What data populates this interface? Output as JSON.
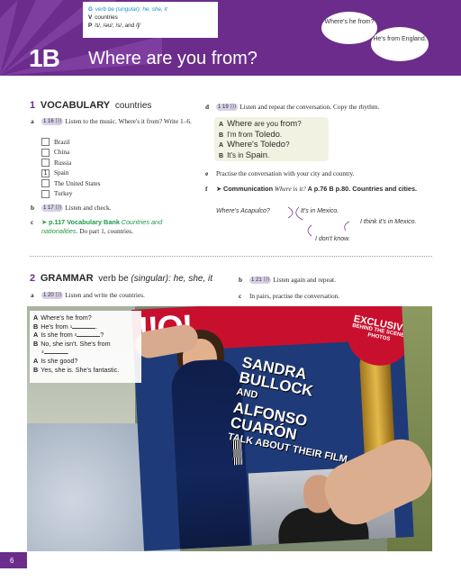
{
  "header": {
    "objectives": {
      "grammar_label": "G",
      "grammar_text": "verb be (singular): he, she, it",
      "vocab_label": "V",
      "vocab_text": "countries",
      "pron_label": "P",
      "pron_text": "/ɪ/, /əʊ/, /s/, and /ʃ/"
    },
    "lesson_number": "1B",
    "lesson_title": "Where are you from?",
    "bubble_question": "Where's he from?",
    "bubble_answer": "He's from England."
  },
  "vocabulary": {
    "num": "1",
    "heading": "VOCABULARY",
    "sub": "countries",
    "a_letter": "a",
    "a_track": "1 16",
    "a_text": "Listen to the music. Where's it from? Write 1–6.",
    "countries": [
      {
        "box": "",
        "name": "Brazil"
      },
      {
        "box": "",
        "name": "China"
      },
      {
        "box": "",
        "name": "Russia"
      },
      {
        "box": "1",
        "name": "Spain"
      },
      {
        "box": "",
        "name": "The United States"
      },
      {
        "box": "",
        "name": "Turkey"
      }
    ],
    "b_letter": "b",
    "b_track": "1 17",
    "b_text": "Listen and check.",
    "c_letter": "c",
    "c_link": "p.117 Vocabulary Bank",
    "c_link_italic": "Countries and nationalities",
    "c_text": ". Do part 1, countries."
  },
  "right_col": {
    "d_letter": "d",
    "d_track": "1 19",
    "d_text": "Listen and repeat the conversation. Copy the rhythm.",
    "dialog": [
      {
        "speaker": "A",
        "pre": "Where",
        "mid": " are you ",
        "post": "from",
        "end": "?"
      },
      {
        "speaker": "B",
        "pre": "I'm from ",
        "mid": "",
        "post": "Toledo",
        "end": "."
      },
      {
        "speaker": "A",
        "pre": "Where's ",
        "mid": "",
        "post": "Toledo",
        "end": "?"
      },
      {
        "speaker": "B",
        "pre": "It's in ",
        "mid": "",
        "post": "Spain",
        "end": "."
      }
    ],
    "e_letter": "e",
    "e_text": "Practise the conversation with your city and country.",
    "f_letter": "f",
    "f_bold": "Communication",
    "f_italic": "Where is it?",
    "f_ref": " A p.76 B p.80. Countries and cities.",
    "hand_q": "Where's Acapulco?",
    "hand_a1": "It's in Mexico.",
    "hand_a2": "I think it's in Mexico.",
    "hand_a3": "I don't know."
  },
  "grammar": {
    "num": "2",
    "heading": "GRAMMAR",
    "sub_plain": "verb be",
    "sub_rest": " (singular): he, she, it",
    "a_letter": "a",
    "a_track": "1 20",
    "a_text": "Listen and write the countries.",
    "b_letter": "b",
    "b_track": "1 21",
    "b_text": "Listen again and repeat.",
    "c_letter": "c",
    "c_text": "In pairs, practise the conversation."
  },
  "photo_dialog": [
    {
      "speaker": "A",
      "text": "Where's he from?"
    },
    {
      "speaker": "B",
      "text": "He's from",
      "gap": "1"
    },
    {
      "speaker": "A",
      "text": "Is she from",
      "gap": "2",
      "end": "?"
    },
    {
      "speaker": "B",
      "text": "No, she isn't. She's from",
      "gap": "3"
    },
    {
      "speaker": "A",
      "text": "Is she good?"
    },
    {
      "speaker": "B",
      "text": "Yes, she is. She's fantastic."
    }
  ],
  "magazine": {
    "exclusive_1": "EXCLUSIVE",
    "exclusive_2": "BEHIND THE SCENES PHOTOS",
    "headline_1": "SANDRA",
    "headline_2": "BULLOCK",
    "headline_3": "AND",
    "headline_4": "ALFONSO CUARÓN",
    "headline_5": "TALK ABOUT THEIR FILM"
  },
  "page_number": "6",
  "colors": {
    "purple": "#6b2c8c",
    "green": "#1e9a48",
    "blue": "#1a8fcb"
  }
}
